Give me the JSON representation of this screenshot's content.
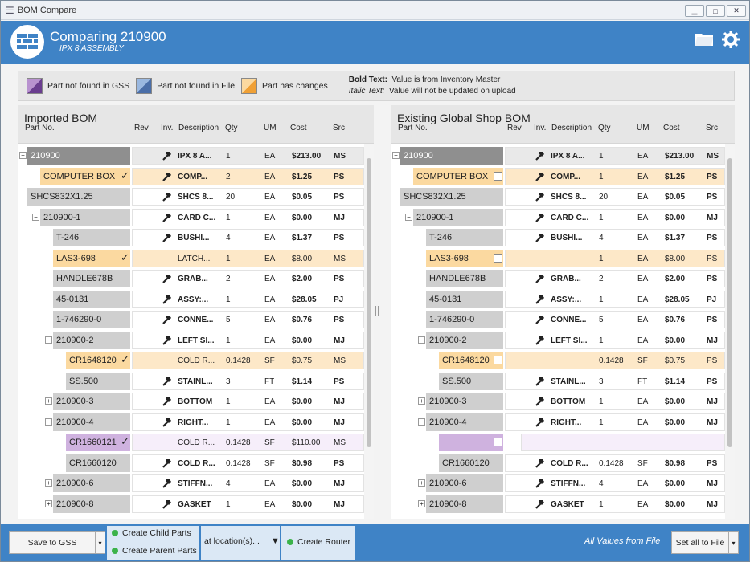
{
  "window": {
    "title": "BOM Compare"
  },
  "header": {
    "title": "Comparing 210900",
    "subtitle": "IPX 8 ASSEMBLY"
  },
  "legend": {
    "items": [
      {
        "label": "Part not found in GSS",
        "color": "#6a3d8f"
      },
      {
        "label": "Part not found in File",
        "color": "#4a6ea8"
      },
      {
        "label": "Part has changes",
        "color": "#f0a035"
      }
    ],
    "bold_key": "Bold Text:",
    "bold_desc": "Value is from Inventory Master",
    "italic_key": "Italic Text:",
    "italic_desc": "Value will not be updated on upload"
  },
  "columns": {
    "part": "Part No.",
    "rev": "Rev",
    "inv": "Inv.",
    "desc": "Description",
    "qty": "Qty",
    "um": "UM",
    "cost": "Cost",
    "src": "Src"
  },
  "imported": {
    "title": "Imported BOM",
    "rows": [
      {
        "part": "210900",
        "desc": "IPX 8 A...",
        "qty": "1",
        "um": "EA",
        "cost": "$213.00",
        "src": "MS",
        "bold": true
      },
      {
        "part": "COMPUTER BOX",
        "desc": "COMP...",
        "qty": "2",
        "um": "EA",
        "cost": "$1.25",
        "src": "PS",
        "bold": true,
        "checked": "✓"
      },
      {
        "part": "SHCS832X1.25",
        "desc": "SHCS 8...",
        "qty": "20",
        "um": "EA",
        "cost": "$0.05",
        "src": "PS",
        "bold": true
      },
      {
        "part": "210900-1",
        "desc": "CARD C...",
        "qty": "1",
        "um": "EA",
        "cost": "$0.00",
        "src": "MJ",
        "bold": true
      },
      {
        "part": "T-246",
        "desc": "BUSHI...",
        "qty": "4",
        "um": "EA",
        "cost": "$1.37",
        "src": "PS",
        "bold": true
      },
      {
        "part": "LAS3-698",
        "desc": "LATCH...",
        "qty": "1",
        "um": "EA",
        "cost": "$8.00",
        "src": "MS",
        "bold": false,
        "checked": "✓"
      },
      {
        "part": "HANDLE678B",
        "desc": "GRAB...",
        "qty": "2",
        "um": "EA",
        "cost": "$2.00",
        "src": "PS",
        "bold": true
      },
      {
        "part": "45-0131",
        "desc": "ASSY:...",
        "qty": "1",
        "um": "EA",
        "cost": "$28.05",
        "src": "PJ",
        "bold": true
      },
      {
        "part": "1-746290-0",
        "desc": "CONNE...",
        "qty": "5",
        "um": "EA",
        "cost": "$0.76",
        "src": "PS",
        "bold": true
      },
      {
        "part": "210900-2",
        "desc": "LEFT SI...",
        "qty": "1",
        "um": "EA",
        "cost": "$0.00",
        "src": "MJ",
        "bold": true
      },
      {
        "part": "CR1648120",
        "desc": "COLD R...",
        "qty": "0.1428",
        "um": "SF",
        "cost": "$0.75",
        "src": "MS",
        "bold": false,
        "checked": "✓"
      },
      {
        "part": "SS.500",
        "desc": "STAINL...",
        "qty": "3",
        "um": "FT",
        "cost": "$1.14",
        "src": "PS",
        "bold": true
      },
      {
        "part": "210900-3",
        "desc": "BOTTOM",
        "qty": "1",
        "um": "EA",
        "cost": "$0.00",
        "src": "MJ",
        "bold": true
      },
      {
        "part": "210900-4",
        "desc": "RIGHT...",
        "qty": "1",
        "um": "EA",
        "cost": "$0.00",
        "src": "MJ",
        "bold": true
      },
      {
        "part": "CR1660121",
        "desc": "COLD R...",
        "qty": "0.1428",
        "um": "SF",
        "cost": "$110.00",
        "src": "MS",
        "bold": false,
        "checked": "✓"
      },
      {
        "part": "CR1660120",
        "desc": "COLD R...",
        "qty": "0.1428",
        "um": "SF",
        "cost": "$0.98",
        "src": "PS",
        "bold": true
      },
      {
        "part": "210900-6",
        "desc": "STIFFN...",
        "qty": "4",
        "um": "EA",
        "cost": "$0.00",
        "src": "MJ",
        "bold": true
      },
      {
        "part": "210900-8",
        "desc": "GASKET",
        "qty": "1",
        "um": "EA",
        "cost": "$0.00",
        "src": "MJ",
        "bold": true
      }
    ]
  },
  "existing": {
    "title": "Existing Global Shop BOM",
    "rows": [
      {
        "part": "210900",
        "desc": "IPX 8 A...",
        "qty": "1",
        "um": "EA",
        "cost": "$213.00",
        "src": "MS",
        "bold": true
      },
      {
        "part": "COMPUTER BOX",
        "desc": "COMP...",
        "qty": "1",
        "um": "EA",
        "cost": "$1.25",
        "src": "PS",
        "bold": true
      },
      {
        "part": "SHCS832X1.25",
        "desc": "SHCS 8...",
        "qty": "20",
        "um": "EA",
        "cost": "$0.05",
        "src": "PS",
        "bold": true
      },
      {
        "part": "210900-1",
        "desc": "CARD C...",
        "qty": "1",
        "um": "EA",
        "cost": "$0.00",
        "src": "MJ",
        "bold": true
      },
      {
        "part": "T-246",
        "desc": "BUSHI...",
        "qty": "4",
        "um": "EA",
        "cost": "$1.37",
        "src": "PS",
        "bold": true
      },
      {
        "part": "LAS3-698",
        "desc": "",
        "qty": "1",
        "um": "EA",
        "cost": "$8.00",
        "src": "PS",
        "bold": false
      },
      {
        "part": "HANDLE678B",
        "desc": "GRAB...",
        "qty": "2",
        "um": "EA",
        "cost": "$2.00",
        "src": "PS",
        "bold": true
      },
      {
        "part": "45-0131",
        "desc": "ASSY:...",
        "qty": "1",
        "um": "EA",
        "cost": "$28.05",
        "src": "PJ",
        "bold": true
      },
      {
        "part": "1-746290-0",
        "desc": "CONNE...",
        "qty": "5",
        "um": "EA",
        "cost": "$0.76",
        "src": "PS",
        "bold": true
      },
      {
        "part": "210900-2",
        "desc": "LEFT SI...",
        "qty": "1",
        "um": "EA",
        "cost": "$0.00",
        "src": "MJ",
        "bold": true
      },
      {
        "part": "CR1648120",
        "desc": "",
        "qty": "0.1428",
        "um": "SF",
        "cost": "$0.75",
        "src": "PS",
        "bold": false
      },
      {
        "part": "SS.500",
        "desc": "STAINL...",
        "qty": "3",
        "um": "FT",
        "cost": "$1.14",
        "src": "PS",
        "bold": true
      },
      {
        "part": "210900-3",
        "desc": "BOTTOM",
        "qty": "1",
        "um": "EA",
        "cost": "$0.00",
        "src": "MJ",
        "bold": true
      },
      {
        "part": "210900-4",
        "desc": "RIGHT...",
        "qty": "1",
        "um": "EA",
        "cost": "$0.00",
        "src": "MJ",
        "bold": true
      },
      {
        "part": "",
        "desc": "",
        "qty": "",
        "um": "",
        "cost": "",
        "src": "",
        "bold": false
      },
      {
        "part": "CR1660120",
        "desc": "COLD R...",
        "qty": "0.1428",
        "um": "SF",
        "cost": "$0.98",
        "src": "PS",
        "bold": true
      },
      {
        "part": "210900-6",
        "desc": "STIFFN...",
        "qty": "4",
        "um": "EA",
        "cost": "$0.00",
        "src": "MJ",
        "bold": true
      },
      {
        "part": "210900-8",
        "desc": "GASKET",
        "qty": "1",
        "um": "EA",
        "cost": "$0.00",
        "src": "MJ",
        "bold": true
      }
    ]
  },
  "footer": {
    "save_label": "Save to GSS",
    "create_child": "Create Child Parts",
    "create_parent": "Create Parent Parts",
    "location_label": "at location(s)...",
    "create_router": "Create Router",
    "note": "All Values from File",
    "set_all": "Set all to File"
  },
  "colors": {
    "accent": "#3f83c6",
    "changed": "#fde8c8",
    "changed_pn": "#fbd9a0",
    "not_in_gss": "#ede0f2",
    "not_in_gss_pn": "#cfb2df"
  }
}
